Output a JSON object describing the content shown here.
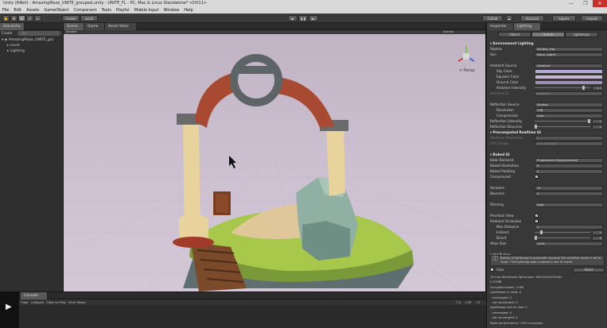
{
  "window": {
    "title": "Unity (64bit) - AmazingMaze_UNITE_grouped.unity - UNITE_FL - PC, Mac & Linux Standalone* <DX11>",
    "controls": [
      "—",
      "❐",
      "✕"
    ]
  },
  "menu": [
    "File",
    "Edit",
    "Assets",
    "GameObject",
    "Component",
    "Tools",
    "Playful",
    "Mobile Input",
    "Window",
    "Help"
  ],
  "toolbar": {
    "center_label": "Center",
    "local_label": "Local",
    "play": "▶",
    "pause": "❚❚",
    "step": "▶|",
    "collab": "Collab",
    "account": "Account",
    "layers": "Layers",
    "layout": "Layout"
  },
  "hierarchy": {
    "tab": "Hierarchy",
    "create": "Create",
    "search_placeholder": "All",
    "items": [
      "AmazingMaze_UNITE_gro",
      "Level",
      "Lighting"
    ]
  },
  "scene": {
    "tabs": [
      "Scene",
      "Game",
      "Asset Store"
    ],
    "shading": "Shaded",
    "gizmos": "Gizmos",
    "persp": "< Persp"
  },
  "inspector": {
    "tabs": [
      "Inspector",
      "Lighting"
    ],
    "subtabs": [
      "Object",
      "Scene",
      "Lightmaps"
    ],
    "rows": [
      {
        "type": "section",
        "label": "Environment Lighting"
      },
      {
        "label": "Skybox",
        "value": "Skybox_Fog"
      },
      {
        "label": "Sun",
        "value": "None (Light)"
      },
      {
        "label": "",
        "value": ""
      },
      {
        "label": "Ambient Source",
        "value": "Gradient"
      },
      {
        "label": "Sky Color",
        "color": "#b3a8d8",
        "indent": true
      },
      {
        "label": "Equator Color",
        "color": "#c8b7d4",
        "indent": true
      },
      {
        "label": "Ground Color",
        "color": "#9c8fb0",
        "indent": true
      },
      {
        "label": "Ambient Intensity",
        "slider": 0.9,
        "number": "1.1",
        "indent": true
      },
      {
        "label": "Ambient GI",
        "value": "Realtime",
        "dim": true
      },
      {
        "label": "",
        "value": ""
      },
      {
        "label": "Reflection Source",
        "value": "Skybox"
      },
      {
        "label": "Resolution",
        "value": "128",
        "indent": true
      },
      {
        "label": "Compression",
        "value": "Auto",
        "indent": true
      },
      {
        "label": "Reflection Intensity",
        "slider": 1.0,
        "number": "1"
      },
      {
        "label": "Reflection Bounces",
        "slider": 0.0,
        "number": "1"
      },
      {
        "type": "section",
        "label": "Precomputed Realtime GI"
      },
      {
        "label": "Realtime Resolution",
        "value": "2",
        "dim": true
      },
      {
        "label": "CPU Usage",
        "value": "Low (default)",
        "dim": true
      },
      {
        "label": "",
        "value": ""
      },
      {
        "type": "section",
        "label": "Baked GI"
      },
      {
        "label": "Bake Backend",
        "value": "Progressive (Experimental)"
      },
      {
        "label": "Baked Resolution",
        "value": "8"
      },
      {
        "label": "Baked Padding",
        "value": "2"
      },
      {
        "label": "Compressed",
        "check": "✓"
      },
      {
        "label": "",
        "value": ""
      },
      {
        "label": "Samples",
        "value": "32"
      },
      {
        "label": "Bounces",
        "value": "4"
      },
      {
        "label": "",
        "value": ""
      },
      {
        "label": "Filtering",
        "value": "Auto"
      },
      {
        "label": "",
        "value": ""
      },
      {
        "label": "Prioritize View",
        "check": "✓"
      },
      {
        "label": "Ambient Occlusion",
        "check": "✓"
      },
      {
        "label": "Max Distance",
        "value": "1",
        "indent": true
      },
      {
        "label": "Indirect",
        "slider": 0.1,
        "number": "1",
        "indent": true
      },
      {
        "label": "Direct",
        "slider": 0.0,
        "number": "0",
        "indent": true
      },
      {
        "label": "Atlas Size",
        "value": "1024"
      },
      {
        "label": "",
        "value": ""
      },
      {
        "label": "Light Probes",
        "value": ""
      }
    ],
    "info_text": "Baking of lightmaps is automatic because the workflow mode is set to 'Auto'. The lightmap data is stored in the GI cache.",
    "auto_label": "Auto",
    "build_label": "Build",
    "stats": [
      "19 non-directional lightmaps: 16x1024x1024px",
      "0.57MB",
      "Occupied texels: 2.9M",
      "Lightmaps in view: 0",
      "  converged: 0",
      "  not converged: 0",
      "Lightmaps out of view: 0",
      "  converged: 0",
      "  not converged: 0",
      "Bake performance: 0.00 mrays/sec"
    ]
  },
  "console": {
    "tab": "Console",
    "buttons": [
      "Clear",
      "Collapse",
      "Clear on Play",
      "Error Pause"
    ],
    "counts": [
      "0",
      "39",
      "0"
    ]
  }
}
